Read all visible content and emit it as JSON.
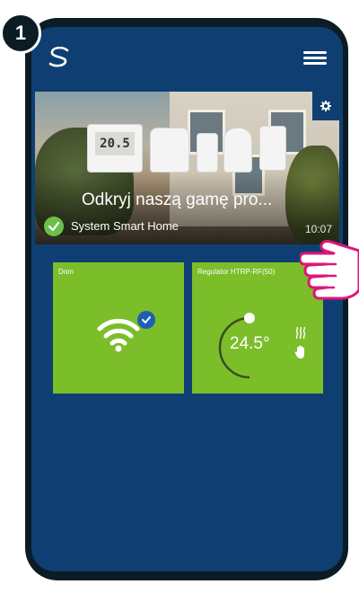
{
  "step": {
    "number": "1"
  },
  "header": {
    "logo_icon": "syncro-logo-icon",
    "menu_icon": "hamburger-menu-icon"
  },
  "banner": {
    "title": "Odkryj naszą gamę pro...",
    "subtitle": "System Smart Home",
    "time": "10:07",
    "device_display": "20.5",
    "status_icon": "check-icon",
    "settings_icon": "gear-icon"
  },
  "tiles": [
    {
      "label": "Dom",
      "icon": "wifi-icon",
      "badge_icon": "verified-check-icon"
    },
    {
      "label": "Regulator HTRP-RF(50)",
      "temperature": "24.5°",
      "icons": [
        "heating-icon",
        "manual-mode-hand-icon"
      ]
    }
  ],
  "colors": {
    "screen_bg": "#0f3f72",
    "tile_green": "#7cbd2a",
    "accent_check": "#6cc04a",
    "badge_blue": "#1e5fb5"
  }
}
